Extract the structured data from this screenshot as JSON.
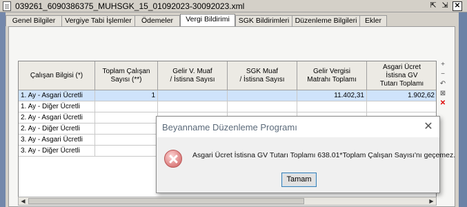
{
  "window": {
    "title": "039261_6090386375_MUHSGK_15_01092023-30092023.xml",
    "restore_glyph": "⇱",
    "maximize_glyph": "⇲",
    "close_glyph": "✕"
  },
  "tabs": [
    {
      "label": "Genel Bilgiler",
      "active": false
    },
    {
      "label": "Vergiye Tabi İşlemler",
      "active": false
    },
    {
      "label": "Ödemeler",
      "active": false
    },
    {
      "label": "Vergi Bildirimi",
      "active": true
    },
    {
      "label": "SGK Bildirimleri",
      "active": false
    },
    {
      "label": "Düzenleme Bilgileri",
      "active": false
    },
    {
      "label": "Ekler",
      "active": false
    }
  ],
  "table": {
    "headers": [
      "Çalışan Bilgisi (*)",
      "Toplam Çalışan\nSayısı (**)",
      "Gelir V. Muaf\n/ İstisna Sayısı",
      "SGK Muaf\n/ İstisna Sayısı",
      "Gelir Vergisi\nMatrahı Toplamı",
      "Asgari Ücret\nİstisna GV\nTutarı Toplamı"
    ],
    "rows": [
      [
        "1. Ay - Asgari Ücretli",
        "1",
        "",
        "",
        "11.402,31",
        "1.902,62"
      ],
      [
        "1. Ay - Diğer Ücretli",
        "",
        "",
        "",
        "",
        ""
      ],
      [
        "2. Ay - Asgari Ücretli",
        "",
        "",
        "",
        "",
        ""
      ],
      [
        "2. Ay - Diğer Ücretli",
        "",
        "",
        "",
        "",
        ""
      ],
      [
        "3. Ay - Asgari Ücretli",
        "",
        "",
        "",
        "",
        ""
      ],
      [
        "3. Ay - Diğer Ücretli",
        "",
        "",
        "",
        "",
        ""
      ]
    ]
  },
  "side_tools": [
    "+",
    "−",
    "↶",
    "⊠",
    "✕"
  ],
  "dialog": {
    "title": "Beyanname Düzenleme Programı",
    "close_glyph": "✕",
    "message": "Asgari Ücret İstisna GV Tutarı Toplamı 638.01*Toplam Çalışan Sayısı'nı geçemez.",
    "ok_label": "Tamam"
  },
  "scrollbar": {
    "left_glyph": "◀",
    "right_glyph": "▶"
  }
}
